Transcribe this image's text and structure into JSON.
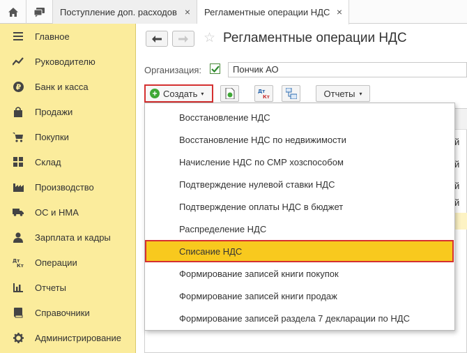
{
  "tabs": [
    {
      "label": "Поступление доп. расходов"
    },
    {
      "label": "Регламентные операции НДС"
    }
  ],
  "tab_close_glyph": "×",
  "sidebar": {
    "items": [
      {
        "label": "Главное",
        "icon": "menu-lines-icon"
      },
      {
        "label": "Руководителю",
        "icon": "trend-icon"
      },
      {
        "label": "Банк и касса",
        "icon": "ruble-coin-icon"
      },
      {
        "label": "Продажи",
        "icon": "shopping-bag-icon"
      },
      {
        "label": "Покупки",
        "icon": "cart-icon"
      },
      {
        "label": "Склад",
        "icon": "warehouse-grid-icon"
      },
      {
        "label": "Производство",
        "icon": "factory-icon"
      },
      {
        "label": "ОС и НМА",
        "icon": "truck-icon"
      },
      {
        "label": "Зарплата и кадры",
        "icon": "person-icon"
      },
      {
        "label": "Операции",
        "icon": "dt-kt-icon"
      },
      {
        "label": "Отчеты",
        "icon": "bar-chart-icon"
      },
      {
        "label": "Справочники",
        "icon": "book-icon"
      },
      {
        "label": "Администрирование",
        "icon": "gear-icon"
      }
    ]
  },
  "header": {
    "title": "Регламентные операции НДС",
    "back_glyph": "←",
    "forward_glyph": "→",
    "star_glyph": "☆"
  },
  "organization": {
    "label": "Организация:",
    "value": "Пончик АО",
    "checked": true
  },
  "toolbar": {
    "create_label": "Создать",
    "reports_label": "Отчеты",
    "dropdown_arrow": "▾",
    "dt_label": "Дт",
    "kt_label": "Кт"
  },
  "list": {
    "row_tails": [
      "й",
      "й",
      "й",
      "й"
    ]
  },
  "dropdown": {
    "items": [
      {
        "label": "Восстановление НДС"
      },
      {
        "label": "Восстановление НДС по недвижимости"
      },
      {
        "label": "Начисление НДС по СМР хозспособом"
      },
      {
        "label": "Подтверждение нулевой ставки НДС"
      },
      {
        "label": "Подтверждение оплаты НДС в бюджет"
      },
      {
        "label": "Распределение НДС"
      },
      {
        "label": "Списание НДС",
        "selected": true
      },
      {
        "label": "Формирование записей книги покупок"
      },
      {
        "label": "Формирование записей книги продаж"
      },
      {
        "label": "Формирование записей раздела 7 декларации по НДС"
      }
    ]
  },
  "colors": {
    "sidebar_bg": "#fbec9c",
    "highlight": "#f8c91e",
    "highlight_border": "#d53030",
    "create_plus": "#3fa836"
  }
}
